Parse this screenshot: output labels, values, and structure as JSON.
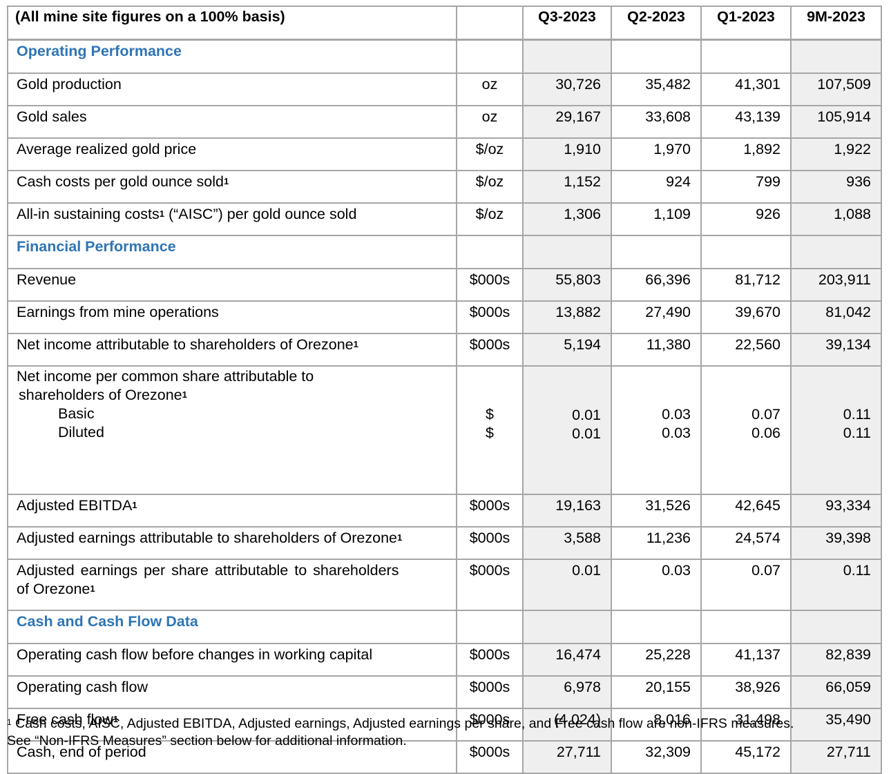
{
  "header": {
    "basis": "(All mine site figures on a 100% basis)",
    "col_q3": "Q3-2023",
    "col_q2": "Q2-2023",
    "col_q1": "Q1-2023",
    "col_9m": "9M-2023"
  },
  "sections": {
    "operating": "Operating Performance",
    "financial": "Financial Performance",
    "cash": "Cash and Cash Flow Data"
  },
  "footnote_marker": "1",
  "rows": {
    "gold_production": {
      "label": "Gold production",
      "unit": "oz",
      "q3": "30,726",
      "q2": "35,482",
      "q1": "41,301",
      "m9": "107,509"
    },
    "gold_sales": {
      "label": "Gold sales",
      "unit": "oz",
      "q3": "29,167",
      "q2": "33,608",
      "q1": "43,139",
      "m9": "105,914"
    },
    "avg_price": {
      "label": "Average realized gold price",
      "unit": "$/oz",
      "q3": "1,910",
      "q2": "1,970",
      "q1": "1,892",
      "m9": "1,922"
    },
    "cash_costs": {
      "label": "Cash costs per gold ounce sold",
      "unit": "$/oz",
      "q3": "1,152",
      "q2": "924",
      "q1": "799",
      "m9": "936"
    },
    "aisc": {
      "label_a": "All-in sustaining costs",
      "label_b": " (“AISC”) per gold ounce sold",
      "unit": "$/oz",
      "q3": "1,306",
      "q2": "1,109",
      "q1": "926",
      "m9": "1,088"
    },
    "revenue": {
      "label": "Revenue",
      "unit": "$000s",
      "q3": "55,803",
      "q2": "66,396",
      "q1": "81,712",
      "m9": "203,911"
    },
    "earnings_mine": {
      "label": "Earnings from mine operations",
      "unit": "$000s",
      "q3": "13,882",
      "q2": "27,490",
      "q1": "39,670",
      "m9": "81,042"
    },
    "net_income": {
      "label": "Net income attributable to shareholders of Orezone",
      "unit": "$000s",
      "q3": "5,194",
      "q2": "11,380",
      "q1": "22,560",
      "m9": "39,134"
    },
    "eps": {
      "label_line1": "Net income per common share attributable to",
      "label_line2": "shareholders of Orezone",
      "basic_label": "Basic",
      "diluted_label": "Diluted",
      "basic_unit": "$",
      "diluted_unit": "$",
      "q3_basic": "0.01",
      "q3_diluted": "0.01",
      "q2_basic": "0.03",
      "q2_diluted": "0.03",
      "q1_basic": "0.07",
      "q1_diluted": "0.06",
      "m9_basic": "0.11",
      "m9_diluted": "0.11"
    },
    "adj_ebitda": {
      "label": "Adjusted EBITDA",
      "unit": "$000s",
      "q3": "19,163",
      "q2": "31,526",
      "q1": "42,645",
      "m9": "93,334"
    },
    "adj_earnings": {
      "label": "Adjusted earnings attributable to shareholders of Orezone",
      "unit": "$000s",
      "q3": "3,588",
      "q2": "11,236",
      "q1": "24,574",
      "m9": "39,398"
    },
    "adj_eps": {
      "label_line1": "Adjusted earnings per share attributable to shareholders",
      "label_line2": "of Orezone",
      "unit": "$000s",
      "q3": "0.01",
      "q2": "0.03",
      "q1": "0.07",
      "m9": "0.11"
    },
    "ocf_before": {
      "label": "Operating cash flow before changes in working capital",
      "unit": "$000s",
      "q3": "16,474",
      "q2": "25,228",
      "q1": "41,137",
      "m9": "82,839"
    },
    "ocf": {
      "label": "Operating cash flow",
      "unit": "$000s",
      "q3": "6,978",
      "q2": "20,155",
      "q1": "38,926",
      "m9": "66,059"
    },
    "fcf": {
      "label": "Free cash flow",
      "unit": "$000s",
      "q3": "(4,024)",
      "q2": "8,016",
      "q1": "31,498",
      "m9": "35,490"
    },
    "cash_end": {
      "label": "Cash, end of period",
      "unit": "$000s",
      "q3": "27,711",
      "q2": "32,309",
      "q1": "45,172",
      "m9": "27,711"
    }
  },
  "footnote": {
    "line1": "Cash costs, AISC, Adjusted EBITDA, Adjusted earnings, Adjusted earnings per share, and Free cash flow are non-IFRS measures.",
    "line2": "See “Non-IFRS Measures” section below for additional information."
  }
}
